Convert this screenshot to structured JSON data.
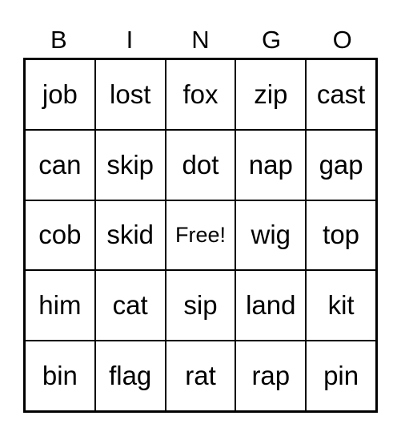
{
  "header": [
    "B",
    "I",
    "N",
    "G",
    "O"
  ],
  "rows": [
    [
      "job",
      "lost",
      "fox",
      "zip",
      "cast"
    ],
    [
      "can",
      "skip",
      "dot",
      "nap",
      "gap"
    ],
    [
      "cob",
      "skid",
      "Free!",
      "wig",
      "top"
    ],
    [
      "him",
      "cat",
      "sip",
      "land",
      "kit"
    ],
    [
      "bin",
      "flag",
      "rat",
      "rap",
      "pin"
    ]
  ]
}
